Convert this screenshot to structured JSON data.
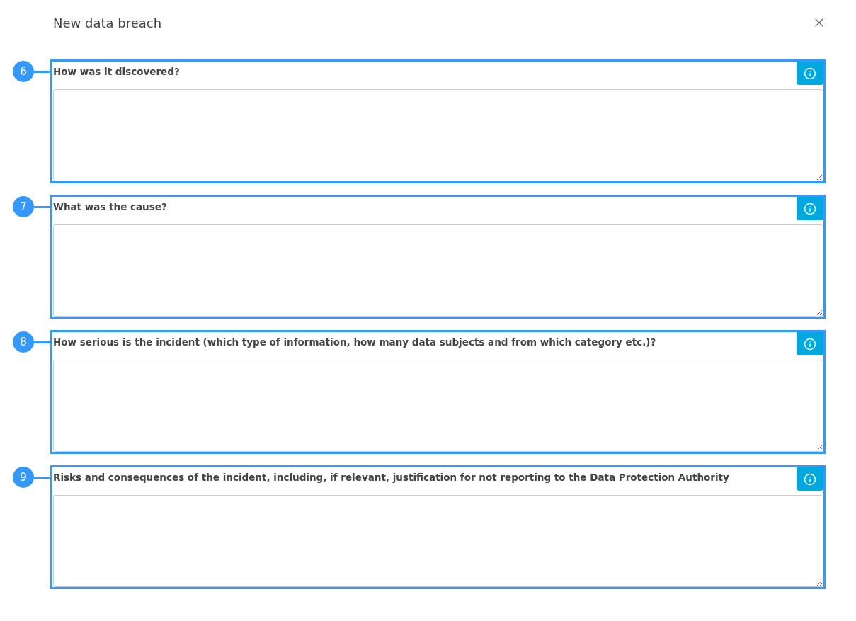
{
  "dialog": {
    "title": "New data breach"
  },
  "sections": [
    {
      "number": "6",
      "label": "How was it discovered?"
    },
    {
      "number": "7",
      "label": "What was the cause?"
    },
    {
      "number": "8",
      "label": "How serious is the incident (which type of information, how many data subjects and from which category etc.)?"
    },
    {
      "number": "9",
      "label": "Risks and consequences of the incident, including, if relevant, justification for not reporting to the Data Protection Authority"
    }
  ]
}
